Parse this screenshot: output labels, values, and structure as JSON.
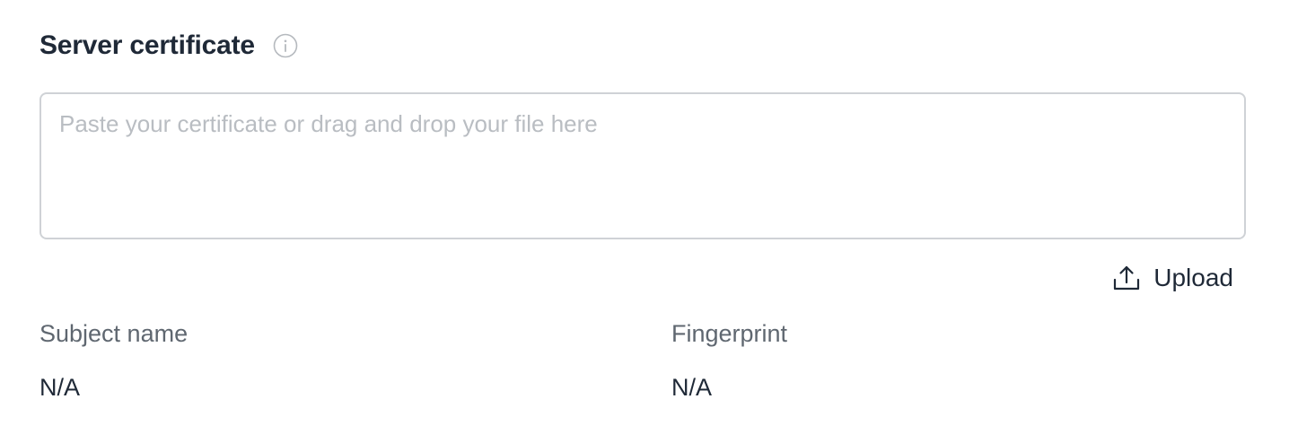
{
  "section": {
    "title": "Server certificate",
    "info_icon": "info-icon"
  },
  "certificate_input": {
    "value": "",
    "placeholder": "Paste your certificate or drag and drop your file here"
  },
  "upload": {
    "label": "Upload",
    "icon": "upload-icon"
  },
  "fields": {
    "subject_name": {
      "label": "Subject name",
      "value": "N/A"
    },
    "fingerprint": {
      "label": "Fingerprint",
      "value": "N/A"
    }
  },
  "colors": {
    "title": "#1f2937",
    "label": "#5f6770",
    "placeholder": "#b9bdc2",
    "border": "#cfd2d6"
  }
}
